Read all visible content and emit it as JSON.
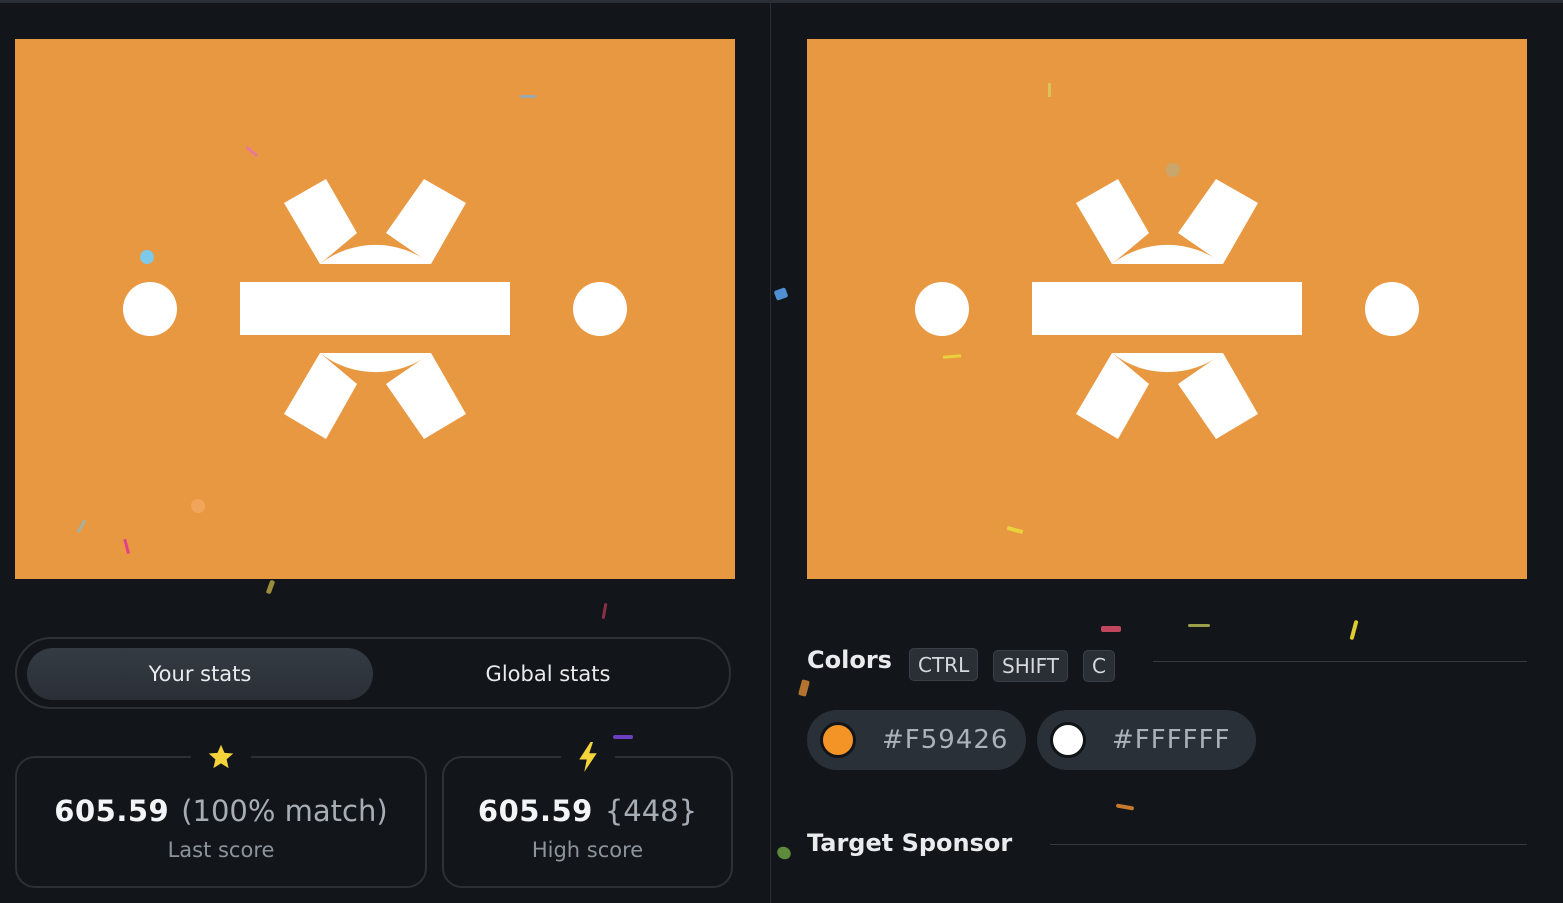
{
  "stats": {
    "tabs": [
      {
        "label": "Your stats",
        "active": true
      },
      {
        "label": "Global stats",
        "active": false
      }
    ],
    "last_score": {
      "value": "605.59",
      "detail": "(100% match)",
      "label": "Last score",
      "icon": "star-icon",
      "icon_color": "#F5D33B"
    },
    "high_score": {
      "value": "605.59",
      "detail": "{448}",
      "label": "High score",
      "icon": "lightning-icon",
      "icon_color": "#F5D33B"
    }
  },
  "colors": {
    "title": "Colors",
    "shortcut": [
      "CTRL",
      "SHIFT",
      "C"
    ],
    "swatches": [
      {
        "hex": "#F59426",
        "display": "#F59426"
      },
      {
        "hex": "#FFFFFF",
        "display": "#FFFFFF"
      }
    ]
  },
  "sponsor": {
    "title": "Target Sponsor"
  },
  "canvas": {
    "background": "#E99842",
    "foreground": "#FFFFFF"
  }
}
